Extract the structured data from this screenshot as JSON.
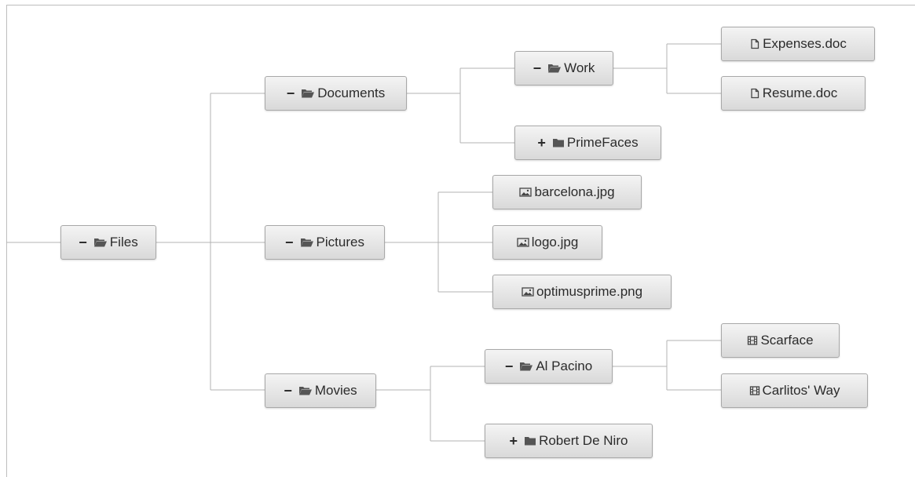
{
  "tree": {
    "root": {
      "label": "Files",
      "toggle": "−"
    },
    "documents": {
      "label": "Documents",
      "toggle": "−"
    },
    "work": {
      "label": "Work",
      "toggle": "−"
    },
    "expenses": {
      "label": "Expenses.doc"
    },
    "resume": {
      "label": "Resume.doc"
    },
    "primefaces": {
      "label": "PrimeFaces",
      "toggle": "+"
    },
    "pictures": {
      "label": "Pictures",
      "toggle": "−"
    },
    "barcelona": {
      "label": "barcelona.jpg"
    },
    "logo": {
      "label": "logo.jpg"
    },
    "optimus": {
      "label": "optimusprime.png"
    },
    "movies": {
      "label": "Movies",
      "toggle": "−"
    },
    "pacino": {
      "label": "Al Pacino",
      "toggle": "−"
    },
    "scarface": {
      "label": "Scarface"
    },
    "carlitos": {
      "label": "Carlitos' Way"
    },
    "deniro": {
      "label": "Robert De Niro",
      "toggle": "+"
    }
  },
  "icons": {
    "folder_open": "folder-open-icon",
    "folder_closed": "folder-closed-icon",
    "document": "document-icon",
    "image": "image-icon",
    "film": "film-icon"
  }
}
